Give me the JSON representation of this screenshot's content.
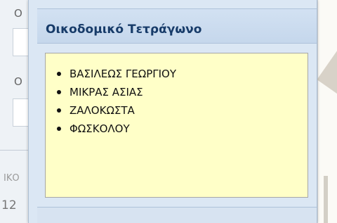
{
  "background_form": {
    "letters": [
      "O",
      "O"
    ],
    "label_fragment": "ΙΚΟ",
    "number_fragment": "12"
  },
  "panel": {
    "title": "Οικοδομικό Τετράγωνο",
    "streets": [
      "ΒΑΣΙΛΕΩΣ ΓΕΩΡΓΙΟΥ",
      "ΜΙΚΡΑΣ ΑΣΙΑΣ",
      "ΖΑΛΟΚΩΣΤΑ",
      "ΦΩΣΚΟΛΟΥ"
    ]
  },
  "colors": {
    "panel_bg": "#dbe7f4",
    "header_text": "#173b69",
    "content_bg": "#ffffc8"
  }
}
